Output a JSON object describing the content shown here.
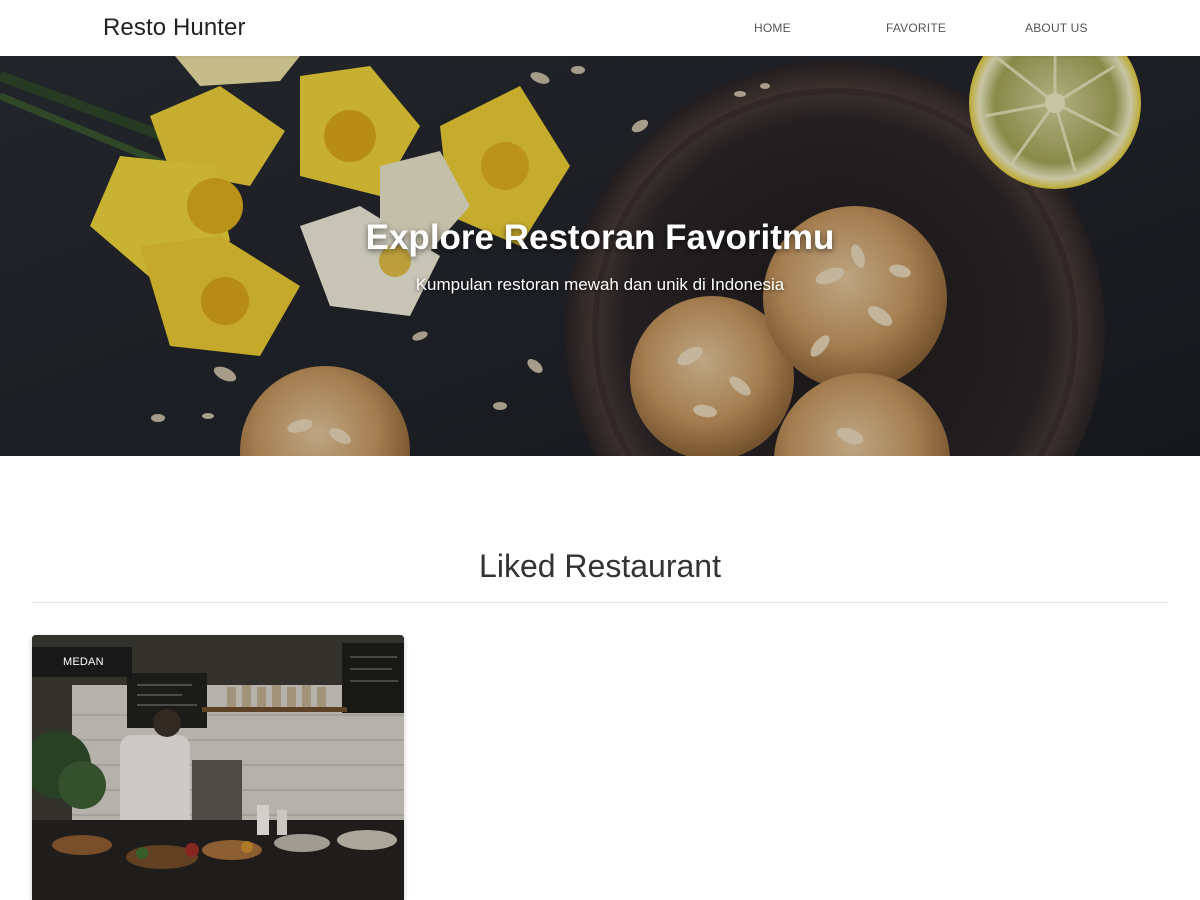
{
  "header": {
    "brand": "Resto Hunter",
    "nav": [
      "HOME",
      "FAVORITE",
      "ABOUT US"
    ]
  },
  "hero": {
    "title": "Explore Restoran Favoritmu",
    "subtitle": "Kumpulan restoran mewah dan unik di Indonesia"
  },
  "section": {
    "title": "Liked Restaurant"
  },
  "cards": [
    {
      "city": "MEDAN"
    }
  ],
  "colors": {
    "app_bar": "#ffffff",
    "brand_text": "#222222",
    "nav_text": "#555555",
    "hero_bg": "#23262c",
    "section_title": "#333333",
    "badge_bg": "#141414"
  }
}
